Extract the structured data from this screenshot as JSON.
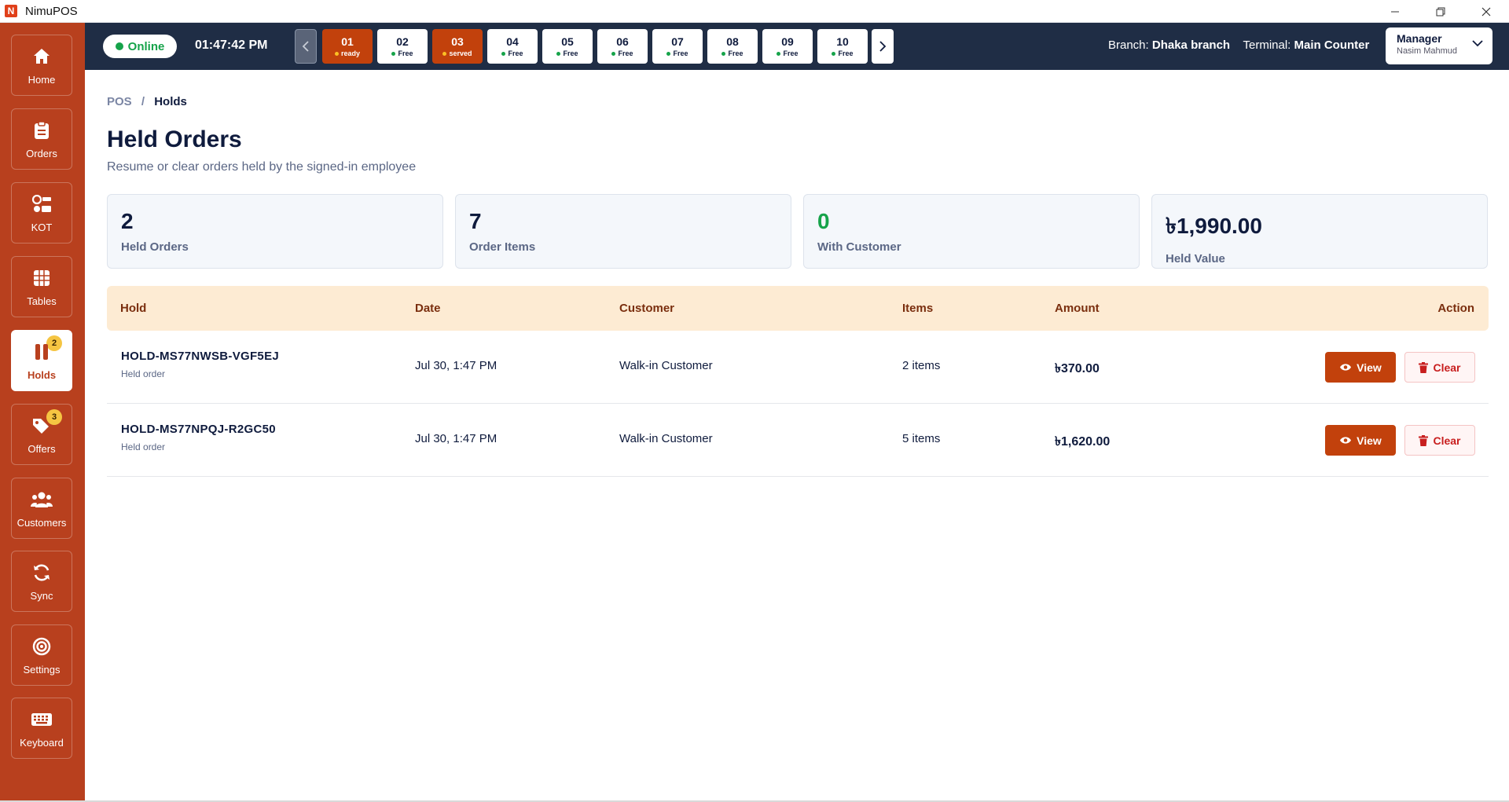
{
  "window": {
    "logo_letter": "N",
    "title": "NimuPOS"
  },
  "sidebar": {
    "items": [
      {
        "label": "Home"
      },
      {
        "label": "Orders"
      },
      {
        "label": "KOT"
      },
      {
        "label": "Tables"
      },
      {
        "label": "Holds",
        "badge": "2"
      },
      {
        "label": "Offers",
        "badge": "3"
      },
      {
        "label": "Customers"
      },
      {
        "label": "Sync"
      },
      {
        "label": "Settings"
      },
      {
        "label": "Keyboard"
      }
    ]
  },
  "topbar": {
    "status": "Online",
    "clock": "01:47:42 PM",
    "tables": [
      {
        "num": "01",
        "status": "ready"
      },
      {
        "num": "02",
        "status": "Free"
      },
      {
        "num": "03",
        "status": "served"
      },
      {
        "num": "04",
        "status": "Free"
      },
      {
        "num": "05",
        "status": "Free"
      },
      {
        "num": "06",
        "status": "Free"
      },
      {
        "num": "07",
        "status": "Free"
      },
      {
        "num": "08",
        "status": "Free"
      },
      {
        "num": "09",
        "status": "Free"
      },
      {
        "num": "10",
        "status": "Free"
      }
    ],
    "branch_label": "Branch:",
    "branch_value": "Dhaka branch",
    "terminal_label": "Terminal:",
    "terminal_value": "Main Counter",
    "user_role": "Manager",
    "user_name": "Nasim Mahmud"
  },
  "breadcrumb": {
    "root": "POS",
    "separator": "/",
    "current": "Holds"
  },
  "page": {
    "title": "Held Orders",
    "subtitle": "Resume or clear orders held by the signed-in employee"
  },
  "stats": [
    {
      "value": "2",
      "label": "Held Orders"
    },
    {
      "value": "7",
      "label": "Order Items"
    },
    {
      "value": "0",
      "label": "With Customer"
    },
    {
      "value": "৳1,990.00",
      "label": "Held Value"
    }
  ],
  "table": {
    "headers": {
      "hold": "Hold",
      "date": "Date",
      "customer": "Customer",
      "items": "Items",
      "amount": "Amount",
      "action": "Action"
    },
    "rows": [
      {
        "id": "HOLD-MS77NWSB-VGF5EJ",
        "sub": "Held order",
        "date": "Jul 30, 1:47 PM",
        "customer": "Walk-in Customer",
        "items": "2 items",
        "amount": "৳370.00",
        "view": "View",
        "clear": "Clear"
      },
      {
        "id": "HOLD-MS77NPQJ-R2GC50",
        "sub": "Held order",
        "date": "Jul 30, 1:47 PM",
        "customer": "Walk-in Customer",
        "items": "5 items",
        "amount": "৳1,620.00",
        "view": "View",
        "clear": "Clear"
      }
    ]
  },
  "colors": {
    "sidebar": "#b8401e",
    "topbar": "#1f2d45",
    "accent": "#c2410c",
    "online": "#16a34a",
    "header_bg": "#fdebd3"
  }
}
